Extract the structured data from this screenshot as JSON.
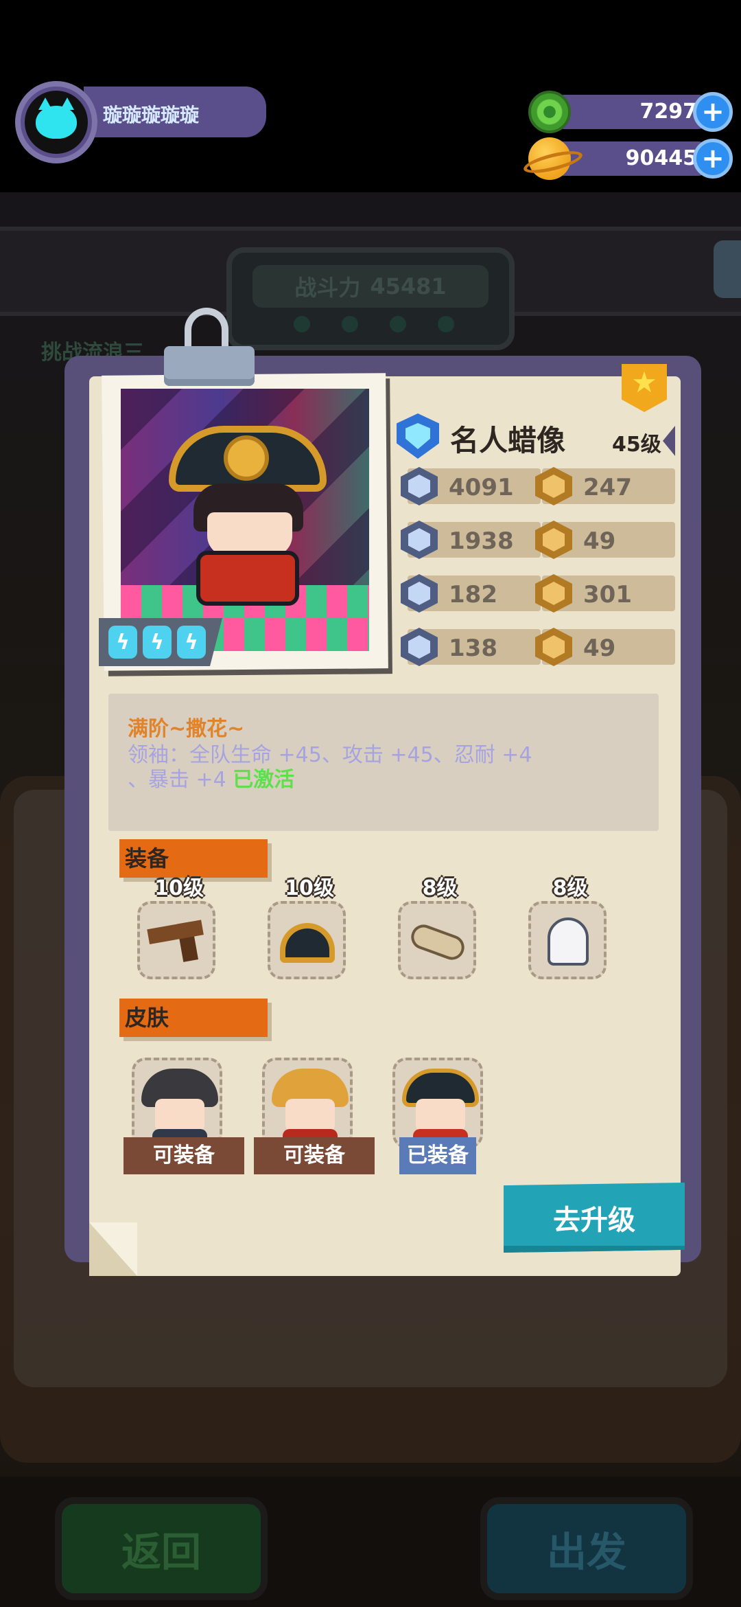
{
  "hud": {
    "player_name": "璇璇璇璇璇",
    "gems": "7297",
    "coins": "90445",
    "plus_symbol": "+"
  },
  "background": {
    "power_label": "战斗力",
    "power_value": "45481",
    "challenge_text": "挑战流浪三",
    "back_button": "返回",
    "go_button": "出发"
  },
  "character": {
    "name": "名人蜡像",
    "level": "45级",
    "stats": [
      {
        "icon": "heart-shield-icon",
        "value": "4091"
      },
      {
        "icon": "cup-icon",
        "value": "247"
      },
      {
        "icon": "sword-icon",
        "value": "1938"
      },
      {
        "icon": "smile-icon",
        "value": "49"
      },
      {
        "icon": "armor-icon",
        "value": "182"
      },
      {
        "icon": "muscle-icon",
        "value": "301"
      },
      {
        "icon": "anchor-icon",
        "value": "138"
      },
      {
        "icon": "brain-icon",
        "value": "49"
      }
    ],
    "energy_count": 3
  },
  "description": {
    "title": "满阶~撒花~",
    "line1": "领袖：全队生命 +45、攻击 +45、忍耐 +4",
    "line2_prefix": "、暴击 +4 ",
    "active_label": "已激活"
  },
  "equipment": {
    "label": "装备",
    "items": [
      {
        "name": "pistol-icon",
        "level": "10级"
      },
      {
        "name": "bicorne-hat-icon",
        "level": "10级"
      },
      {
        "name": "bones-icon",
        "level": "8级"
      },
      {
        "name": "ghost-penguin-icon",
        "level": "8级"
      }
    ]
  },
  "skins": {
    "label": "皮肤",
    "items": [
      {
        "status": "可装备"
      },
      {
        "status": "可装备"
      },
      {
        "status": "已装备"
      }
    ]
  },
  "upgrade_button": "去升级",
  "colors": {
    "accent_orange": "#e46a14",
    "upgrade_teal": "#22a4b6",
    "active_green": "#5fe04a",
    "hud_purple": "#5a4f8a"
  }
}
